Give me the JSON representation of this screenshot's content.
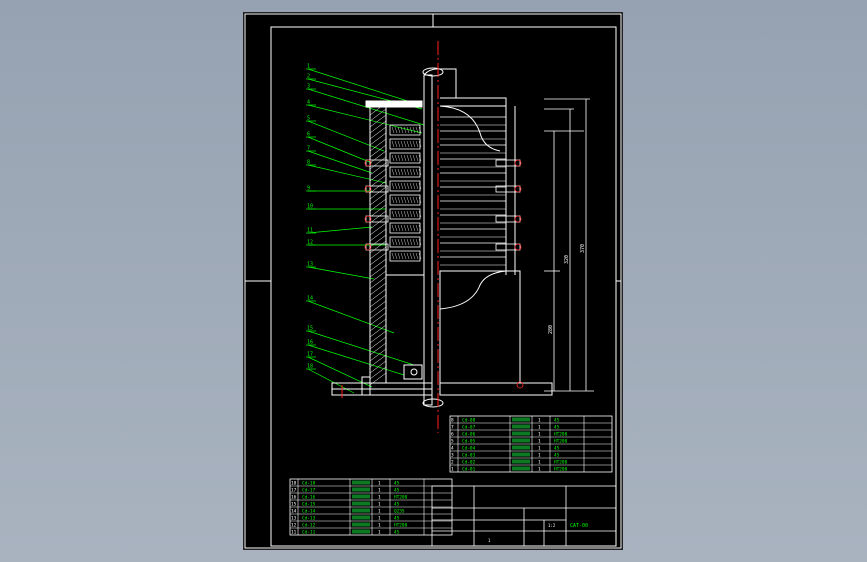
{
  "drawing": {
    "part_callouts": [
      "1",
      "2",
      "3",
      "4",
      "5",
      "6",
      "7",
      "8",
      "9",
      "10",
      "11",
      "12",
      "13",
      "14",
      "15",
      "16",
      "17",
      "18"
    ],
    "dimensions": [
      "370",
      "320",
      "280"
    ],
    "bom_upper": [
      {
        "no": "8",
        "code": "Cd-08",
        "name": "",
        "qty": "1",
        "mat": "45"
      },
      {
        "no": "7",
        "code": "Cd-07",
        "name": "",
        "qty": "1",
        "mat": "45"
      },
      {
        "no": "6",
        "code": "Cd-06",
        "name": "",
        "qty": "1",
        "mat": "HT200"
      },
      {
        "no": "5",
        "code": "Cd-05",
        "name": "",
        "qty": "1",
        "mat": "HT200"
      },
      {
        "no": "4",
        "code": "Cd-04",
        "name": "",
        "qty": "1",
        "mat": "45"
      },
      {
        "no": "3",
        "code": "Cd-03",
        "name": "",
        "qty": "1",
        "mat": "45"
      },
      {
        "no": "2",
        "code": "Cd-02",
        "name": "",
        "qty": "1",
        "mat": "HT200"
      },
      {
        "no": "1",
        "code": "Cd-01",
        "name": "",
        "qty": "1",
        "mat": "HT200"
      }
    ],
    "bom_lower": [
      {
        "no": "18",
        "code": "Cd-18",
        "name": "",
        "qty": "1",
        "mat": "45"
      },
      {
        "no": "17",
        "code": "Cd-17",
        "name": "",
        "qty": "1",
        "mat": "45"
      },
      {
        "no": "16",
        "code": "Cd-16",
        "name": "",
        "qty": "1",
        "mat": "HT200"
      },
      {
        "no": "15",
        "code": "Cd-15",
        "name": "",
        "qty": "1",
        "mat": "45"
      },
      {
        "no": "14",
        "code": "Cd-14",
        "name": "",
        "qty": "1",
        "mat": "Q235"
      },
      {
        "no": "13",
        "code": "Cd-13",
        "name": "",
        "qty": "1",
        "mat": "45"
      },
      {
        "no": "12",
        "code": "Cd-12",
        "name": "",
        "qty": "1",
        "mat": "HT200"
      },
      {
        "no": "11",
        "code": "Cd-11",
        "name": "",
        "qty": "1",
        "mat": "45"
      }
    ],
    "title_block": {
      "drawing_no": "CAT-00",
      "scale": "1:2",
      "sheet": "1"
    },
    "colors": {
      "background": "#000000",
      "outline": "#ffffff",
      "callout": "#00ff00",
      "centerline": "#ff2020",
      "accent": "#ff3030",
      "dim": "#ffffff"
    }
  }
}
